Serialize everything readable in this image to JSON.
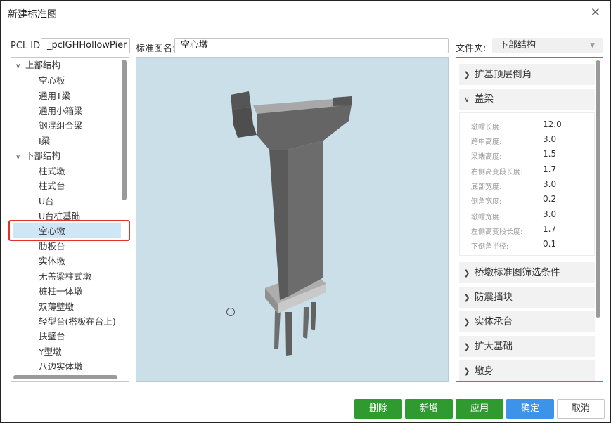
{
  "window": {
    "title": "新建标准图"
  },
  "form": {
    "pcl_label": "PCL ID:",
    "pcl_value": "_pclGHHollowPier",
    "name_label": "标准图名:",
    "name_value": "空心墩",
    "folder_label": "文件夹:",
    "folder_value": "下部结构"
  },
  "tree": {
    "groups": [
      {
        "label": "上部结构",
        "items": [
          "空心板",
          "通用T梁",
          "通用小箱梁",
          "钢混组合梁",
          "I梁"
        ]
      },
      {
        "label": "下部结构",
        "items": [
          "柱式墩",
          "柱式台",
          "U台",
          "U台桩基础",
          "空心墩",
          "肋板台",
          "实体墩",
          "无盖梁柱式墩",
          "桩柱一体墩",
          "双薄壁墩",
          "轻型台(搭板在台上)",
          "扶壁台",
          "Y型墩",
          "八边实体墩"
        ]
      }
    ],
    "selected": "空心墩"
  },
  "panel": {
    "sections": [
      "扩基顶层倒角",
      "盖梁",
      "桥墩标准图筛选条件",
      "防震挡块",
      "实体承台",
      "扩大基础",
      "墩身"
    ],
    "expanded": "盖梁",
    "properties": [
      {
        "label": "墩帽长度:",
        "value": "12.0"
      },
      {
        "label": "跨中高度:",
        "value": "3.0"
      },
      {
        "label": "梁端高度:",
        "value": "1.5"
      },
      {
        "label": "右侧高变段长度:",
        "value": "1.7"
      },
      {
        "label": "底部宽度:",
        "value": "3.0"
      },
      {
        "label": "倒角宽度:",
        "value": "0.2"
      },
      {
        "label": "墩帽宽度:",
        "value": "3.0"
      },
      {
        "label": "左侧高变段长度:",
        "value": "1.7"
      },
      {
        "label": "下倒角半径:",
        "value": "0.1"
      }
    ]
  },
  "buttons": {
    "delete": "删除",
    "add": "新增",
    "apply": "应用",
    "ok": "确定",
    "cancel": "取消"
  },
  "colors": {
    "accent_green": "#2f9a2f",
    "accent_blue": "#3d93e8",
    "highlight_red": "#e2302a",
    "viewport_bg": "#cadfe8"
  }
}
